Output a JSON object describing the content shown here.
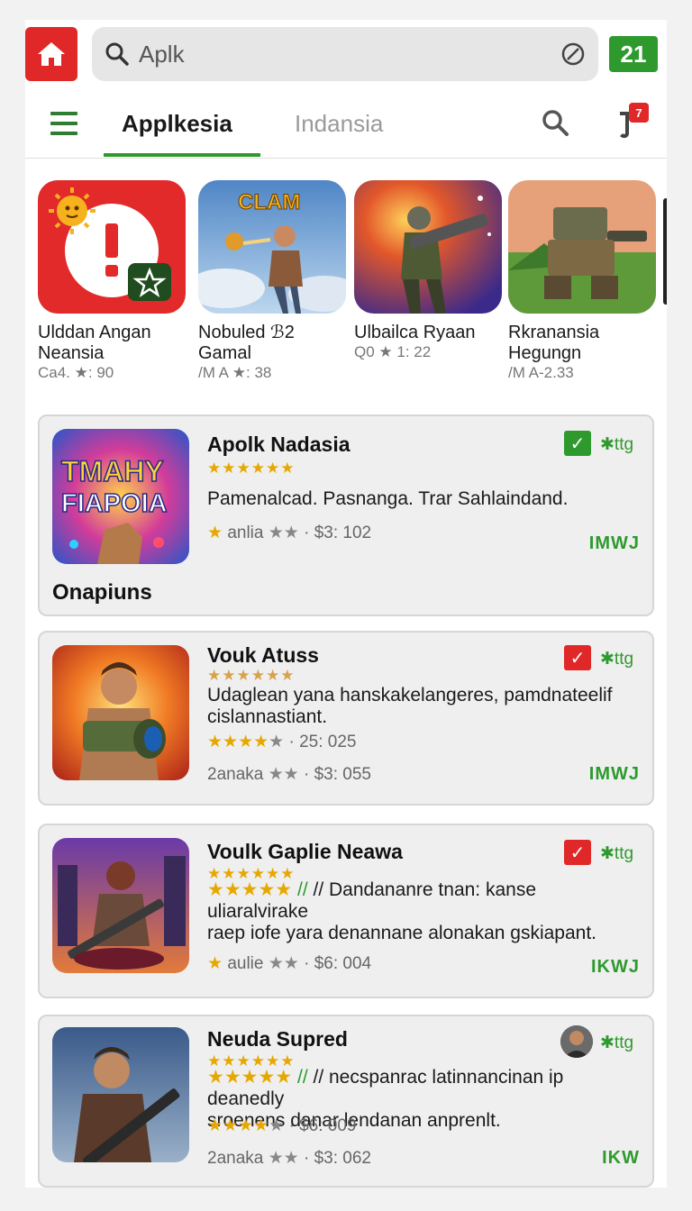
{
  "search": {
    "query": "Aplk",
    "counter": "21"
  },
  "tabs": {
    "active": "Applkesia",
    "inactive": "Indansia",
    "notification_count": "7"
  },
  "carousel": [
    {
      "name": "Ulddan Angan Neansia",
      "meta": "Ca4. ★: 90"
    },
    {
      "name": "Nobuled ℬ2 Gamal",
      "meta": "/M A ★: 38"
    },
    {
      "name": "Ulbailca Ryaan",
      "meta": "Q0 ★ 1: 22"
    },
    {
      "name": "Rkranansia Hegungn",
      "meta": "/M A-2.33"
    }
  ],
  "carousel_badges": {
    "thumb1_art": "CLAM"
  },
  "cards": [
    {
      "title": "Apolk Nadasia",
      "stars": "★★★★★★",
      "description": "Pamenalcad. Pasnanga. Trar Sahlaindand.",
      "meta_label": "anlia",
      "meta_value": "$3: 102",
      "tag": "✱ttg",
      "corner_code": "IMWJ",
      "footer": "Onapiuns",
      "art_text_1": "TMAHY",
      "art_text_2": "FIAPOIA"
    },
    {
      "title": "Vouk Atuss",
      "stars": "★★★★★★",
      "description": "Udaglean yana hanskakelangeres, pamdnateelif cislannastiant.",
      "rating_value": "25: 025",
      "meta_label": "2anaka",
      "meta_value": "$3: 055",
      "tag": "✱ttg",
      "corner_code": "IMWJ"
    },
    {
      "title": "Voulk Gaplie Neawa",
      "stars": "★★★★★★",
      "description_prefix": "// Dandananre tnan: kanse uliaralvirake",
      "description": "raep iofe yara denannane alonakan gskiapant.",
      "meta_label": "aulie",
      "meta_value": "$6: 004",
      "tag": "✱ttg",
      "corner_code": "IKWJ"
    },
    {
      "title": "Neuda Supred",
      "stars": "★★★★★★",
      "description_prefix": "// necspanrac latinnancinan ip deanedly",
      "description": "sroenens danar lendanan anprenlt.",
      "rating_value": "$6: 009",
      "meta_label": "2anaka",
      "meta_value": "$3: 062",
      "tag": "✱ttg",
      "corner_code": "IKW"
    }
  ],
  "colors": {
    "brand_red": "#e02828",
    "brand_green": "#2e9a2e",
    "star": "#e6a800"
  }
}
